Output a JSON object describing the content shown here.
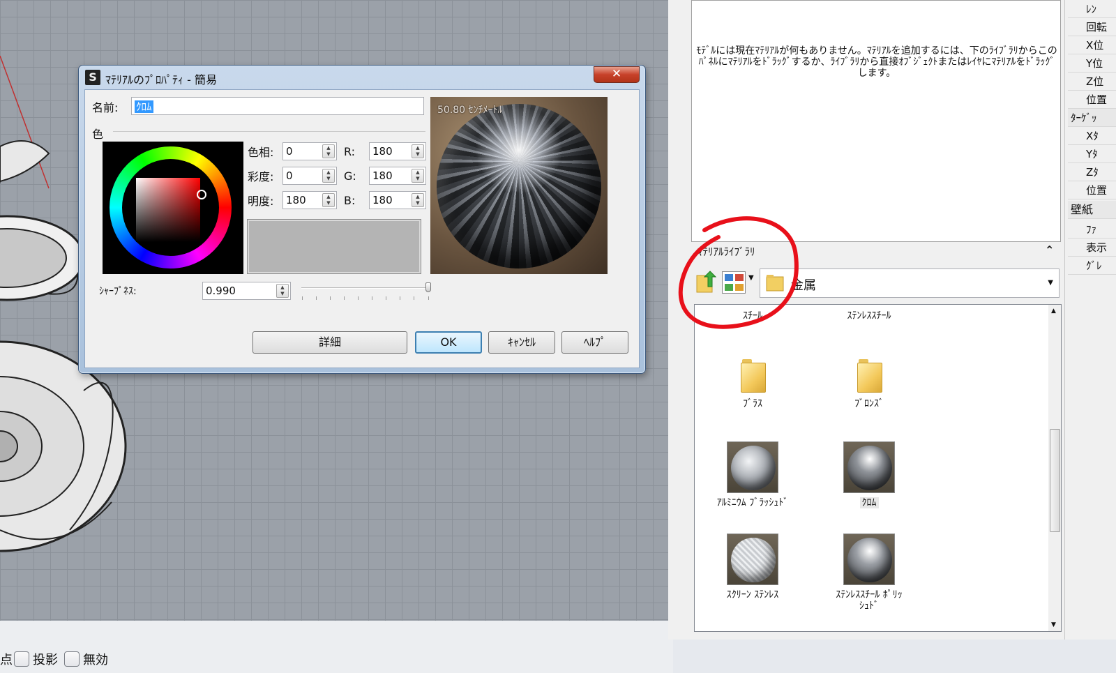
{
  "dialog": {
    "title": "ﾏﾃﾘｱﾙのﾌﾟﾛﾊﾟﾃｨ - 簡易",
    "close": "✕",
    "name_label": "名前:",
    "name_value": "ｸﾛﾑ",
    "color_label": "色",
    "hue_label": "色相:",
    "hue": "0",
    "sat_label": "彩度:",
    "sat": "0",
    "val_label": "明度:",
    "val": "180",
    "r_label": "R:",
    "r": "180",
    "g_label": "G:",
    "g": "180",
    "b_label": "B:",
    "b": "180",
    "swatch_color": "#b4b4b4",
    "preview_size": "50.80 ｾﾝﾁﾒｰﾄﾙ",
    "sharpness_label": "ｼｬｰﾌﾟﾈｽ:",
    "sharpness": "0.990",
    "buttons": {
      "details": "詳細",
      "ok": "OK",
      "cancel": "ｷｬﾝｾﾙ",
      "help": "ﾍﾙﾌﾟ"
    }
  },
  "materials_panel": {
    "message": "ﾓﾃﾞﾙには現在ﾏﾃﾘｱﾙが何もありません。ﾏﾃﾘｱﾙを追加するには、下のﾗｲﾌﾞﾗﾘからこのﾊﾟﾈﾙにﾏﾃﾘｱﾙをﾄﾞﾗｯｸﾞするか、ﾗｲﾌﾞﾗﾘから直接ｵﾌﾞｼﾞｪｸﾄまたはﾚｲﾔにﾏﾃﾘｱﾙをﾄﾞﾗｯｸﾞします。"
  },
  "library": {
    "title": "ﾏﾃﾘｱﾙﾗｲﾌﾞﾗﾘ",
    "folder": "金属",
    "items": [
      {
        "label": "ｽﾁｰﾙ",
        "kind": "folder"
      },
      {
        "label": "ｽﾃﾝﾚｽｽﾁｰﾙ",
        "kind": "folder"
      },
      {
        "label": "ﾌﾞﾗｽ",
        "kind": "folder"
      },
      {
        "label": "ﾌﾞﾛﾝｽﾞ",
        "kind": "folder"
      },
      {
        "label": "ｱﾙﾐﾆｳﾑ ﾌﾞﾗｯｼｭﾄﾞ",
        "kind": "material"
      },
      {
        "label": "ｸﾛﾑ",
        "kind": "material"
      },
      {
        "label": "ｽｸﾘｰﾝ ｽﾃﾝﾚｽ",
        "kind": "material"
      },
      {
        "label": "ｽﾃﾝﾚｽｽﾁｰﾙ ﾎﾟﾘｯｼｭﾄﾞ",
        "kind": "material"
      }
    ]
  },
  "properties": {
    "rows": [
      "ﾚﾝ",
      "回転",
      "X位",
      "Y位",
      "Z位",
      "位置",
      "ﾀｰｹﾞｯ",
      "Xﾀ",
      "Yﾀ",
      "Zﾀ",
      "位置",
      "壁紙",
      "ﾌｧ",
      "表示",
      "ｸﾞﾚ"
    ]
  },
  "statusbar": {
    "point": "点",
    "project": "投影",
    "disable": "無効"
  },
  "colors": {
    "annotation_red": "#e8101a",
    "accent": "#3399ff"
  }
}
